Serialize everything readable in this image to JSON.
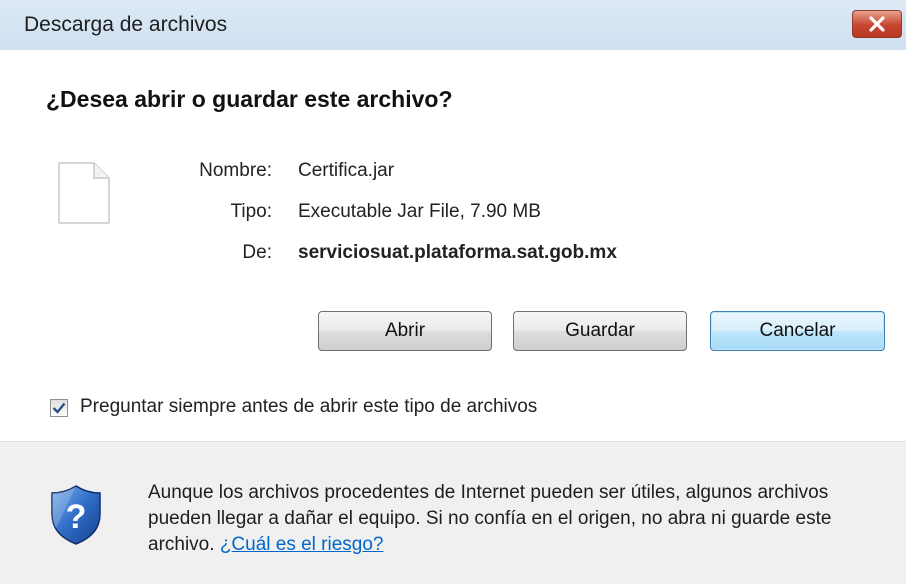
{
  "dialog": {
    "title": "Descarga de archivos",
    "close_icon": "close-icon",
    "heading": "¿Desea abrir o guardar este archivo?",
    "file_icon": "generic-file-icon",
    "fields": {
      "name_label": "Nombre:",
      "name_value": "Certifica.jar",
      "type_label": "Tipo:",
      "type_value": "Executable Jar File, 7.90 MB",
      "from_label": "De:",
      "from_value": "serviciosuat.plataforma.sat.gob.mx"
    },
    "buttons": {
      "open": "Abrir",
      "save": "Guardar",
      "cancel": "Cancelar"
    },
    "checkbox": {
      "label": "Preguntar siempre antes de abrir este tipo de archivos",
      "checked": true
    },
    "warning": {
      "icon": "security-shield-question-icon",
      "text": "Aunque los archivos procedentes de Internet pueden ser útiles, algunos archivos pueden llegar a dañar el equipo. Si no confía en el origen, no abra ni guarde este archivo.",
      "link": "¿Cuál es el riesgo?"
    }
  },
  "colors": {
    "titlebar": "#d6e5f4",
    "close_button": "#c8452e",
    "footer": "#f0f0f0",
    "link": "#0066cc"
  }
}
